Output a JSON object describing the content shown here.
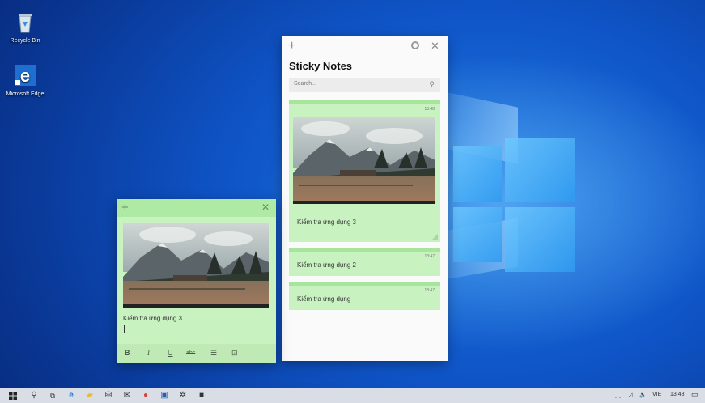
{
  "desktop": {
    "icons": [
      {
        "label": "Recycle Bin",
        "icon": "recycle-bin-icon"
      },
      {
        "label": "Microsoft Edge",
        "icon": "edge-icon"
      }
    ]
  },
  "list_window": {
    "title": "Sticky Notes",
    "search_placeholder": "Search...",
    "notes": [
      {
        "time": "13:48",
        "text": "Kiểm tra ứng dụng 3",
        "has_image": true
      },
      {
        "time": "13:47",
        "text": "Kiểm tra ứng dụng 2",
        "has_image": false
      },
      {
        "time": "13:47",
        "text": "Kiểm tra ứng dụng",
        "has_image": false
      }
    ]
  },
  "note_window": {
    "text": "Kiểm tra ứng dụng 3",
    "toolbar": {
      "bold": "B",
      "italic": "I",
      "underline": "U",
      "strikethrough": "abc",
      "bullets": "☰",
      "image": "⊡"
    }
  },
  "taskbar": {
    "language": "VIE",
    "clock": "13:48"
  },
  "colors": {
    "note_green": "#c9f2c1",
    "note_bar_green": "#a6e59b",
    "desktop_blue": "#0f55c8"
  }
}
